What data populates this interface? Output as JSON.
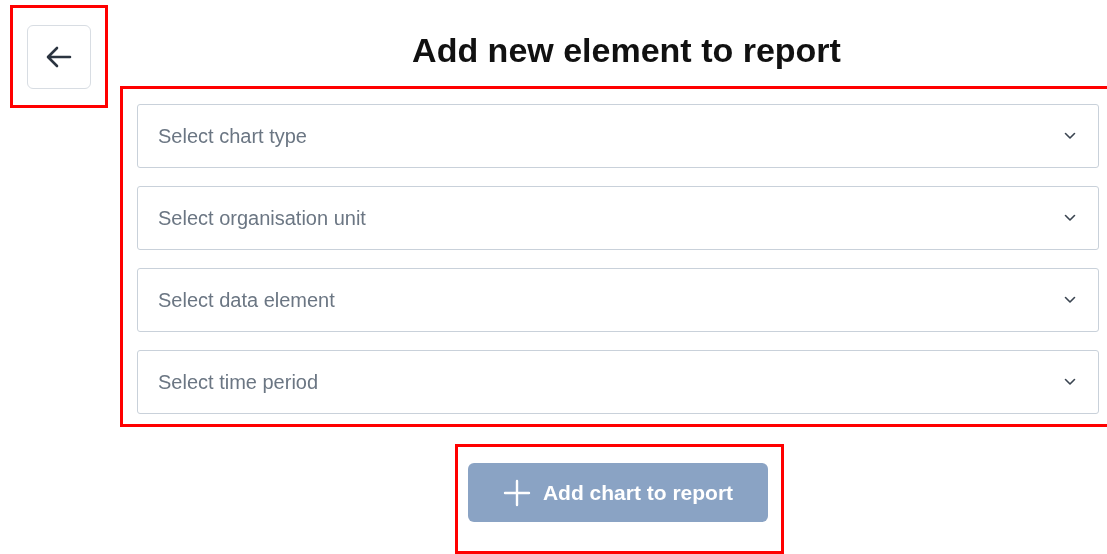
{
  "back_button": {
    "highlighted": true
  },
  "title": "Add new element to report",
  "selects_highlighted": true,
  "selects": [
    {
      "placeholder": "Select chart type"
    },
    {
      "placeholder": "Select organisation unit"
    },
    {
      "placeholder": "Select data element"
    },
    {
      "placeholder": "Select time period"
    }
  ],
  "add_button": {
    "label": "Add chart to report",
    "disabled": true,
    "highlighted": true
  }
}
